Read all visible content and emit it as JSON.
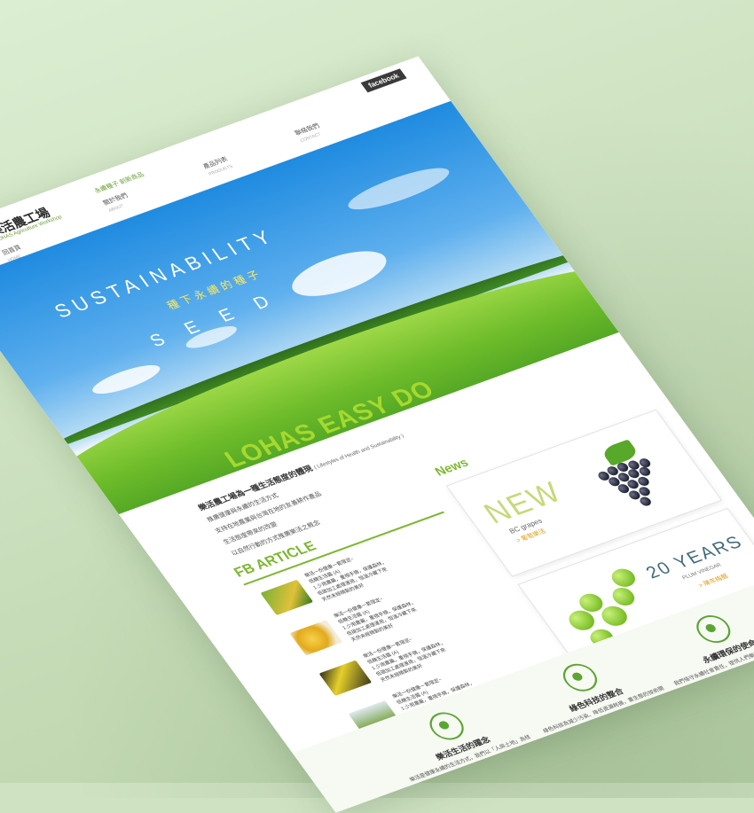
{
  "header": {
    "logo_title": "樂活農工場",
    "logo_sub": "LOHAS Agriculture Workshop",
    "facebook_label": "facebook",
    "nav": [
      {
        "label": "回首頁",
        "en": "HOME"
      },
      {
        "label": "關於我們",
        "en": "ABOUT"
      },
      {
        "label": "永續種子 創新商品",
        "en": "",
        "active": true
      },
      {
        "label": "產品列表",
        "en": "PRODUCTS"
      },
      {
        "label": "聯絡我們",
        "en": "CONTACT"
      }
    ]
  },
  "hero": {
    "title": "SUSTAINABILITY",
    "subtitle_cn": "種下永續的種子",
    "seed": "SEED",
    "slogan": "LOHAS EASY DO"
  },
  "intro": {
    "heading": "樂活農工場為一種生活態度的體現",
    "heading_en": "( Lifestyles of Health and Sustainability )",
    "lines": [
      "推廣健康與永續的生活方式",
      "支持在地農業與台灣在地的友善耕作產品",
      "生活態度帶來的改變",
      "以自然行動的方式推廣樂活之概念"
    ]
  },
  "fb": {
    "title": "FB ARTICLE",
    "articles": [
      {
        "line1": "樂活一份健康一套限定~",
        "line2": "低糖生活醬 (A)",
        "line3": "1.少用農藥，重視手摘，保護森林，",
        "line4": "低碳加工處理運用，恒溫冷藏下來",
        "line5": "天然未經精製的美好"
      },
      {
        "line1": "樂活一份健康一套限定~",
        "line2": "低糖生活醬 (A)",
        "line3": "1.少用農藥，重視手摘，保護森林，",
        "line4": "低碳加工處理運用，恒溫冷藏下來",
        "line5": "天然未經精製的美好"
      },
      {
        "line1": "樂活一份健康一套限定~",
        "line2": "低糖生活醬 (A)",
        "line3": "1.少用農藥，重視手摘，保護森林，",
        "line4": "低碳加工處理運用，恒溫冷藏下來",
        "line5": "天然未經精製的美好"
      },
      {
        "line1": "樂活一份健康一套限定~",
        "line2": "低糖生活醬 (A)",
        "line3": "1.少用農藥，重視手摘，保護森林，",
        "line4": "低碳加工處理運用，恒溫冷藏下來",
        "line5": "天然未經精製的美好"
      }
    ]
  },
  "news": {
    "title": "News",
    "card1": {
      "big": "NEW",
      "sub": "BC grapes",
      "tag": "> 葡萄樂活"
    },
    "card2": {
      "big": "20 YEARS",
      "sub": "PLUM VINEGAR",
      "tag": "> 陳年梅醋"
    }
  },
  "values": [
    {
      "title": "樂活生活的躍念",
      "text": "樂活是健康永續的生活方式，我們以「人與土地」為核心，在生活中實踐"
    },
    {
      "title": "綠色科技的整合",
      "text": "綠色科技為減少污染、降低資源耗損，重生態的技術開發，讓產業與環境共好"
    },
    {
      "title": "永續環保的使命",
      "text": "我們恪守永續社會責任，提供人們樂活的生活態度，打造友善環境的使命"
    }
  ],
  "colors": {
    "brand_green": "#7cb82f",
    "dark_green": "#2e7d32",
    "accent_orange": "#e0a020"
  }
}
